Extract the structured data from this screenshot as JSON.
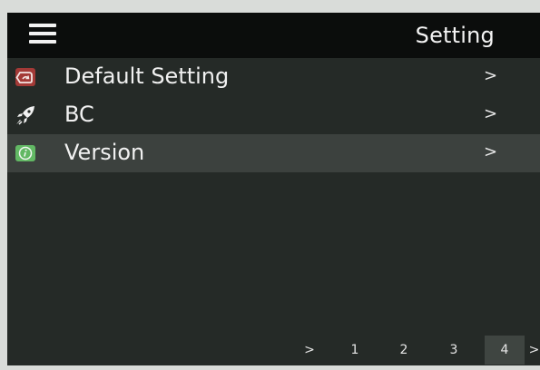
{
  "header": {
    "title": "Setting",
    "menu_icon": "hamburger-menu-icon"
  },
  "menu": {
    "items": [
      {
        "label": "Default Setting",
        "icon": "reset-tag-icon",
        "icon_color": "#a33a37",
        "chevron": ">"
      },
      {
        "label": "BC",
        "icon": "rocket-icon",
        "icon_color": "#f2f2f2",
        "chevron": ">"
      },
      {
        "label": "Version",
        "icon": "info-icon",
        "icon_color": "#62b864",
        "chevron": ">",
        "selected": true
      }
    ]
  },
  "pagination": {
    "prev": ">",
    "pages": [
      "1",
      "2",
      "3",
      "4"
    ],
    "current": "4",
    "next": ">"
  }
}
